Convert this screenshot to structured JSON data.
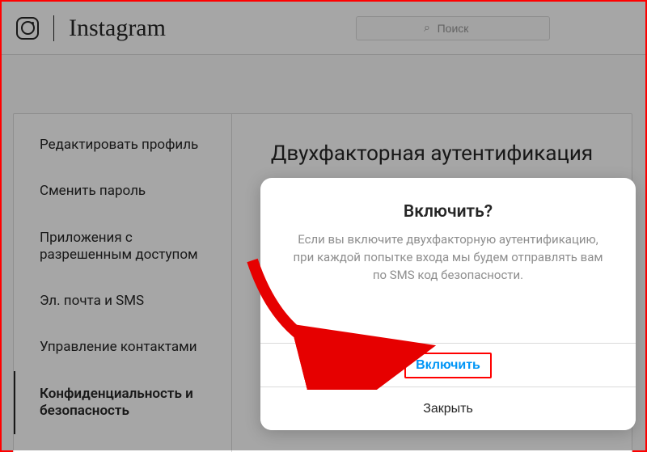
{
  "header": {
    "brand": "Instagram",
    "search_placeholder": "Поиск"
  },
  "sidebar": {
    "items": [
      {
        "label": "Редактировать профиль"
      },
      {
        "label": "Сменить пароль"
      },
      {
        "label": "Приложения с разрешенным доступом"
      },
      {
        "label": "Эл. почта и SMS"
      },
      {
        "label": "Управление контактами"
      },
      {
        "label": "Конфиденциальность и безопасность"
      }
    ],
    "active_index": 5
  },
  "main": {
    "title": "Двухфакторная аутентификация"
  },
  "modal": {
    "title": "Включить?",
    "body": "Если вы включите двухфакторную аутентификацию, при каждой попытке входа мы будем отправлять вам по SMS код безопасности.",
    "primary_label": "Включить",
    "secondary_label": "Закрыть"
  }
}
